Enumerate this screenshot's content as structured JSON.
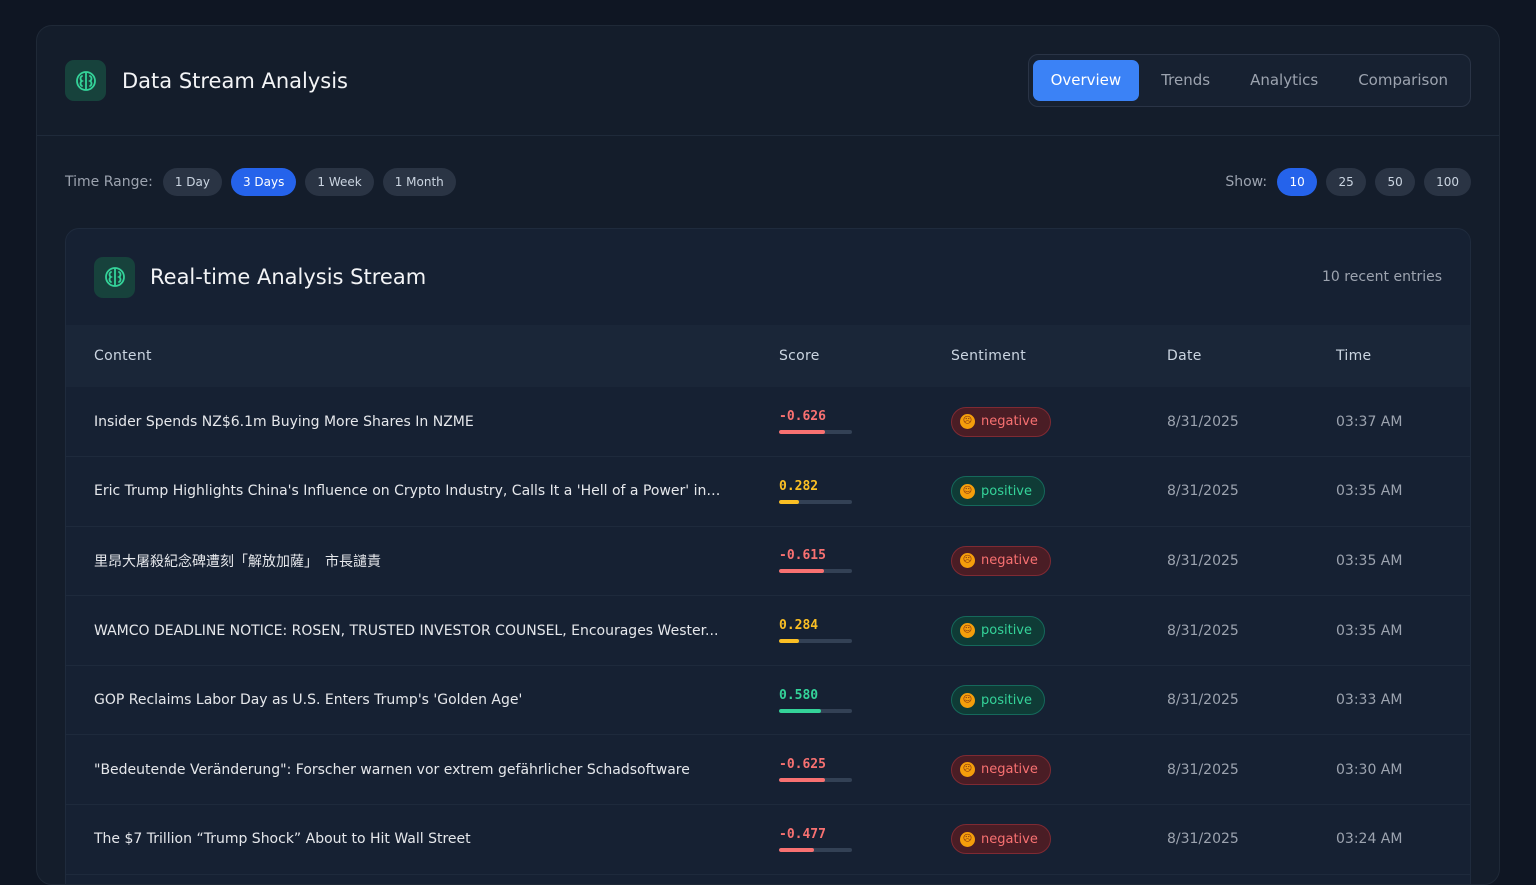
{
  "header": {
    "title": "Data Stream Analysis",
    "tabs": [
      {
        "label": "Overview",
        "active": true
      },
      {
        "label": "Trends",
        "active": false
      },
      {
        "label": "Analytics",
        "active": false
      },
      {
        "label": "Comparison",
        "active": false
      }
    ]
  },
  "filters": {
    "time_range_label": "Time Range:",
    "time_ranges": [
      {
        "label": "1 Day",
        "active": false
      },
      {
        "label": "3 Days",
        "active": true
      },
      {
        "label": "1 Week",
        "active": false
      },
      {
        "label": "1 Month",
        "active": false
      }
    ],
    "show_label": "Show:",
    "show_options": [
      {
        "label": "10",
        "active": true
      },
      {
        "label": "25",
        "active": false
      },
      {
        "label": "50",
        "active": false
      },
      {
        "label": "100",
        "active": false
      }
    ]
  },
  "panel": {
    "title": "Real-time Analysis Stream",
    "count": "10 recent entries",
    "columns": [
      "Content",
      "Score",
      "Sentiment",
      "Date",
      "Time"
    ],
    "rows": [
      {
        "content": "Insider Spends NZ$6.1m Buying More Shares In NZME",
        "score": "-0.626",
        "score_level": 0.63,
        "tone": "neg",
        "sentiment": "negative",
        "date": "8/31/2025",
        "time": "03:37 AM"
      },
      {
        "content": "Eric Trump Highlights China's Influence on Crypto Industry, Calls It a 'Hell of a Power' in ...",
        "score": "0.282",
        "score_level": 0.28,
        "tone": "mid",
        "sentiment": "positive",
        "date": "8/31/2025",
        "time": "03:35 AM"
      },
      {
        "content": "里昂大屠殺紀念碑遭刻「解放加薩」　市長譴責",
        "score": "-0.615",
        "score_level": 0.62,
        "tone": "neg",
        "sentiment": "negative",
        "date": "8/31/2025",
        "time": "03:35 AM"
      },
      {
        "content": "WAMCO DEADLINE NOTICE: ROSEN, TRUSTED INVESTOR COUNSEL, Encourages Wester...",
        "score": "0.284",
        "score_level": 0.28,
        "tone": "mid",
        "sentiment": "positive",
        "date": "8/31/2025",
        "time": "03:35 AM"
      },
      {
        "content": "GOP Reclaims Labor Day as U.S. Enters Trump's 'Golden Age'",
        "score": "0.580",
        "score_level": 0.58,
        "tone": "pos",
        "sentiment": "positive",
        "date": "8/31/2025",
        "time": "03:33 AM"
      },
      {
        "content": "\"Bedeutende Veränderung\": Forscher warnen vor extrem gefährlicher Schadsoftware",
        "score": "-0.625",
        "score_level": 0.63,
        "tone": "neg",
        "sentiment": "negative",
        "date": "8/31/2025",
        "time": "03:30 AM"
      },
      {
        "content": "The $7 Trillion “Trump Shock” About to Hit Wall Street",
        "score": "-0.477",
        "score_level": 0.48,
        "tone": "neg",
        "sentiment": "negative",
        "date": "8/31/2025",
        "time": "03:24 AM"
      }
    ]
  },
  "colors": {
    "accent": "#3b82f6",
    "negative": "#f87171",
    "neutral_positive": "#fbbf24",
    "positive": "#34d399"
  },
  "icons": {
    "brand": "brain-icon",
    "panel": "brain-icon",
    "sentiment": "face-emoji-icon"
  }
}
